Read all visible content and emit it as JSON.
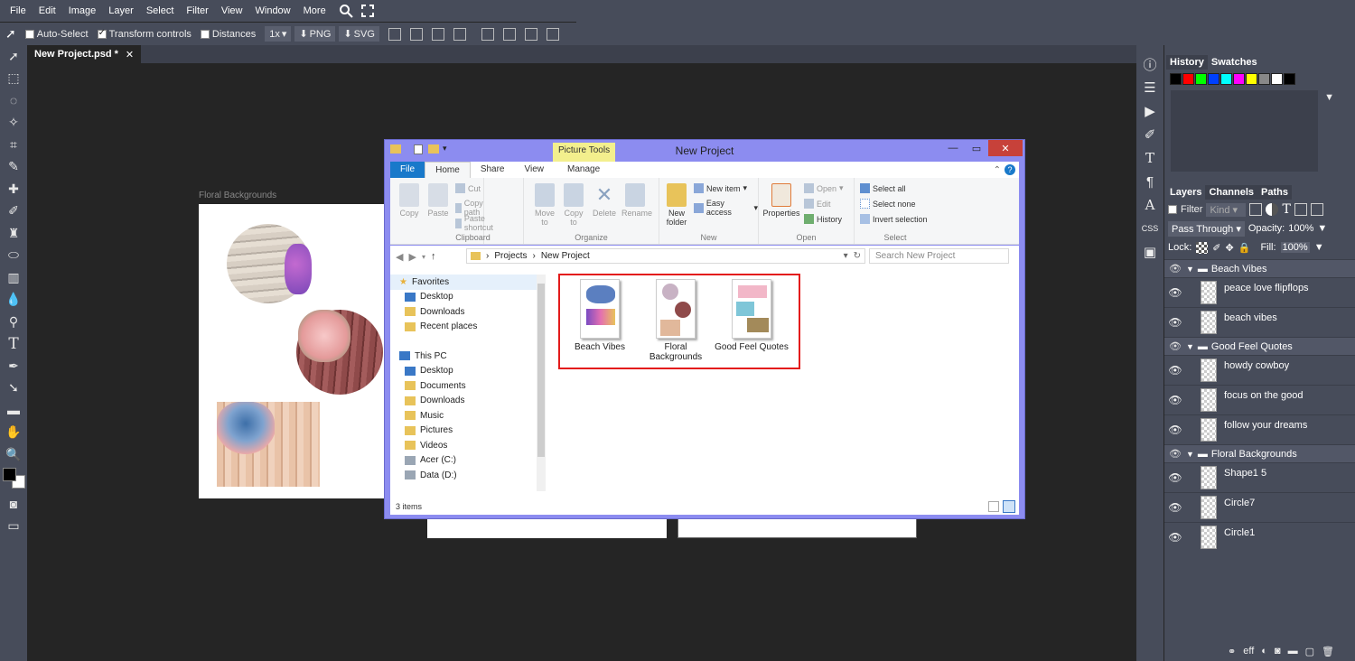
{
  "menu": [
    "File",
    "Edit",
    "Image",
    "Layer",
    "Select",
    "Filter",
    "View",
    "Window",
    "More"
  ],
  "toolbar": {
    "auto_select": "Auto-Select",
    "transform_controls": "Transform controls",
    "distances": "Distances",
    "zoom": "1x",
    "png": "PNG",
    "svg": "SVG"
  },
  "doc_tab": "New Project.psd *",
  "canvas": {
    "label": "Floral Backgrounds"
  },
  "panel": {
    "top_tabs": [
      "History",
      "Swatches"
    ],
    "swatches": [
      "#000000",
      "#ff0000",
      "#00ff00",
      "#0040ff",
      "#00ffff",
      "#ff00ff",
      "#ffff00",
      "#888888",
      "#ffffff",
      "#000000"
    ],
    "layer_tabs": [
      "Layers",
      "Channels",
      "Paths"
    ],
    "filter": "Filter",
    "kind": "Kind",
    "blend": "Pass Through",
    "opacity_label": "Opacity:",
    "opacity": "100%",
    "lock_label": "Lock:",
    "fill_label": "Fill:",
    "fill": "100%",
    "groups": [
      {
        "name": "Beach Vibes",
        "layers": [
          "peace love flipflops",
          "beach vibes"
        ]
      },
      {
        "name": "Good Feel Quotes",
        "layers": [
          "howdy cowboy",
          "focus on the good",
          "follow your dreams"
        ]
      },
      {
        "name": "Floral Backgrounds",
        "layers": [
          "Shape1 5",
          "Circle7",
          "Circle1"
        ]
      }
    ],
    "footer": "eff"
  },
  "explorer": {
    "title": "New Project",
    "picture_tools": "Picture Tools",
    "tabs": [
      "File",
      "Home",
      "Share",
      "View",
      "Manage"
    ],
    "ribbon": {
      "clipboard": {
        "name": "Clipboard",
        "copy": "Copy",
        "paste": "Paste",
        "cut": "Cut",
        "copy_path": "Copy path",
        "paste_shortcut": "Paste shortcut"
      },
      "organize": {
        "name": "Organize",
        "move_to": "Move to",
        "copy_to": "Copy to",
        "delete": "Delete",
        "rename": "Rename"
      },
      "new": {
        "name": "New",
        "new_folder": "New folder",
        "new_item": "New item",
        "easy_access": "Easy access"
      },
      "open": {
        "name": "Open",
        "properties": "Properties",
        "open": "Open",
        "edit": "Edit",
        "history": "History"
      },
      "select": {
        "name": "Select",
        "select_all": "Select all",
        "select_none": "Select none",
        "invert": "Invert selection"
      }
    },
    "path": [
      "Projects",
      "New Project"
    ],
    "search_placeholder": "Search New Project",
    "nav": {
      "favorites": "Favorites",
      "fav_items": [
        "Desktop",
        "Downloads",
        "Recent places"
      ],
      "this_pc": "This PC",
      "pc_items": [
        "Desktop",
        "Documents",
        "Downloads",
        "Music",
        "Pictures",
        "Videos",
        "Acer (C:)",
        "Data (D:)"
      ]
    },
    "folders": [
      {
        "name": "Beach Vibes"
      },
      {
        "name": "Floral Backgrounds"
      },
      {
        "name": "Good Feel Quotes"
      }
    ],
    "status": "3 items"
  },
  "colors": {
    "accent_blue": "#1979ca",
    "highlight_red": "#e31b1b",
    "panel_bg": "#474c5a"
  }
}
